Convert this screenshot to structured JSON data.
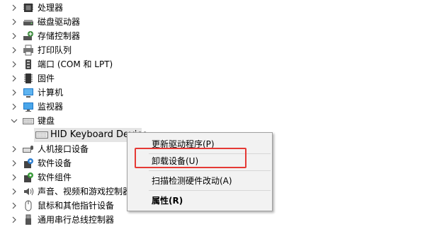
{
  "tree": {
    "items": [
      {
        "label": "处理器",
        "icon": "processor-icon"
      },
      {
        "label": "磁盘驱动器",
        "icon": "disk-drive-icon"
      },
      {
        "label": "存储控制器",
        "icon": "storage-controller-icon"
      },
      {
        "label": "打印队列",
        "icon": "printer-icon"
      },
      {
        "label": "端口 (COM 和 LPT)",
        "icon": "port-icon"
      },
      {
        "label": "固件",
        "icon": "firmware-icon"
      },
      {
        "label": "计算机",
        "icon": "computer-icon"
      },
      {
        "label": "监视器",
        "icon": "monitor-icon"
      },
      {
        "label": "键盘",
        "icon": "keyboard-icon",
        "expanded": true
      },
      {
        "label": "HID Keyboard Device",
        "icon": "keyboard-device-icon",
        "child": true,
        "selected": true
      },
      {
        "label": "人机接口设备",
        "icon": "hid-icon"
      },
      {
        "label": "软件设备",
        "icon": "software-device-icon"
      },
      {
        "label": "软件组件",
        "icon": "software-component-icon"
      },
      {
        "label": "声音、视频和游戏控制器",
        "icon": "speaker-icon"
      },
      {
        "label": "鼠标和其他指针设备",
        "icon": "mouse-icon"
      },
      {
        "label": "通用串行总线控制器",
        "icon": "usb-icon"
      }
    ]
  },
  "context_menu": {
    "items": [
      {
        "label": "更新驱动程序(P)"
      },
      {
        "label": "卸载设备(U)",
        "highlighted": true
      },
      {
        "label": "扫描检测硬件改动(A)"
      },
      {
        "label": "属性(R)",
        "bold": true
      }
    ]
  },
  "colors": {
    "highlight_box": "#e53935",
    "selection": "#e5e5e5",
    "menu_bg": "#f2f2f2"
  }
}
